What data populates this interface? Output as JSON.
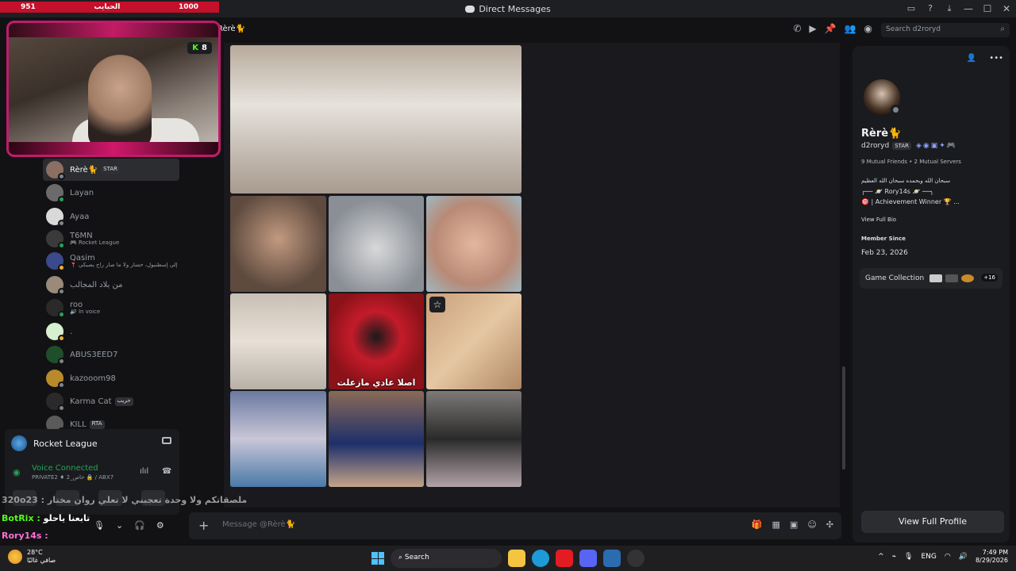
{
  "window": {
    "title": "Direct Messages"
  },
  "overlay": {
    "left_count": "951",
    "label": "الحبايب",
    "right_count": "1000",
    "kick_count": "8"
  },
  "dm_list": [
    {
      "name": "Rèrè🐈",
      "tag": "STAR",
      "sub": "",
      "status": "offline",
      "active": true,
      "avatar": "#8a6f62"
    },
    {
      "name": "Layan",
      "tag": "",
      "sub": "",
      "status": "online",
      "active": false,
      "avatar": "#6b6b6b"
    },
    {
      "name": "Ayaa",
      "tag": "",
      "sub": "",
      "status": "offline",
      "active": false,
      "avatar": "#d9d9d9"
    },
    {
      "name": "T6MN",
      "tag": "",
      "sub": "🎮 Rocket League",
      "status": "online",
      "active": false,
      "avatar": "#3a3a3a"
    },
    {
      "name": "Qasim",
      "tag": "",
      "sub": "📍 إلى إسطنبول، حسار ولا ما صار راح يصيكي\"",
      "status": "idle",
      "active": false,
      "avatar": "#3b4a8a"
    },
    {
      "name": "من بلاد المجالب",
      "tag": "",
      "sub": "",
      "status": "offline",
      "active": false,
      "avatar": "#9a8a7a"
    },
    {
      "name": "roo",
      "tag": "",
      "sub": "🔊 In voice",
      "status": "online",
      "active": false,
      "avatar": "#2a2a2a"
    },
    {
      "name": ".",
      "tag": "",
      "sub": "",
      "status": "idle",
      "active": false,
      "avatar": "#d7f0d0"
    },
    {
      "name": "ABUS3EED7",
      "tag": "",
      "sub": "",
      "status": "offline",
      "active": false,
      "avatar": "#1f4f2a"
    },
    {
      "name": "kazooom98",
      "tag": "",
      "sub": "",
      "status": "offline",
      "active": false,
      "avatar": "#b88a2a"
    },
    {
      "name": "Karma Cat",
      "tag": "حريب",
      "sub": "",
      "status": "offline",
      "active": false,
      "avatar": "#2a2a2a"
    },
    {
      "name": "KILL",
      "tag": "RTA",
      "sub": "",
      "status": "offline",
      "active": false,
      "avatar": "#5a5a5a"
    }
  ],
  "voice_panel": {
    "game": "Rocket League",
    "status": "Voice Connected",
    "channel": "PRIVATE2 ♦ 2_خاص 🔒 / ABX7"
  },
  "stream_chat": [
    {
      "user": "320o23 :",
      "text": "ملصقاتكم ولا وحدة تعجبني لا تعلي روان مختار",
      "color": "#9b9b9b"
    },
    {
      "user": "BotRix :",
      "text": "تابعنا ياحلو",
      "color": "#53fc18"
    },
    {
      "user": "Rory14s :",
      "text": "",
      "color": "#ff6fd8"
    }
  ],
  "header": {
    "recipient": "Rèrè🐈"
  },
  "search": {
    "placeholder": "Search d2roryd"
  },
  "media": {
    "caption": "اصلا عادي مازعلت"
  },
  "composer": {
    "placeholder": "Message @Rèrè🐈"
  },
  "profile": {
    "display_name": "Rèrè🐈",
    "username": "d2roryd",
    "tag": "STAR",
    "mutual": "9 Mutual Friends • 2 Mutual Servers",
    "bio_line1": "سبحان الله وبحمده سبحان الله العظيم",
    "bio_line2": "╭── 🪐 Rory14s 🪐 ──╮",
    "bio_line3": "🎯 | Achievement Winner 🏆 ...",
    "view_full_bio": "View Full Bio",
    "member_since_label": "Member Since",
    "member_since": "Feb 23, 2026",
    "game_collection": "Game Collection",
    "game_more": "+16",
    "view_full_profile": "View Full Profile"
  },
  "taskbar": {
    "temp": "28°C",
    "weather": "صافي غالبًا",
    "search": "Search",
    "lang": "ENG",
    "time": "7:49 PM",
    "date": "8/29/2026"
  }
}
